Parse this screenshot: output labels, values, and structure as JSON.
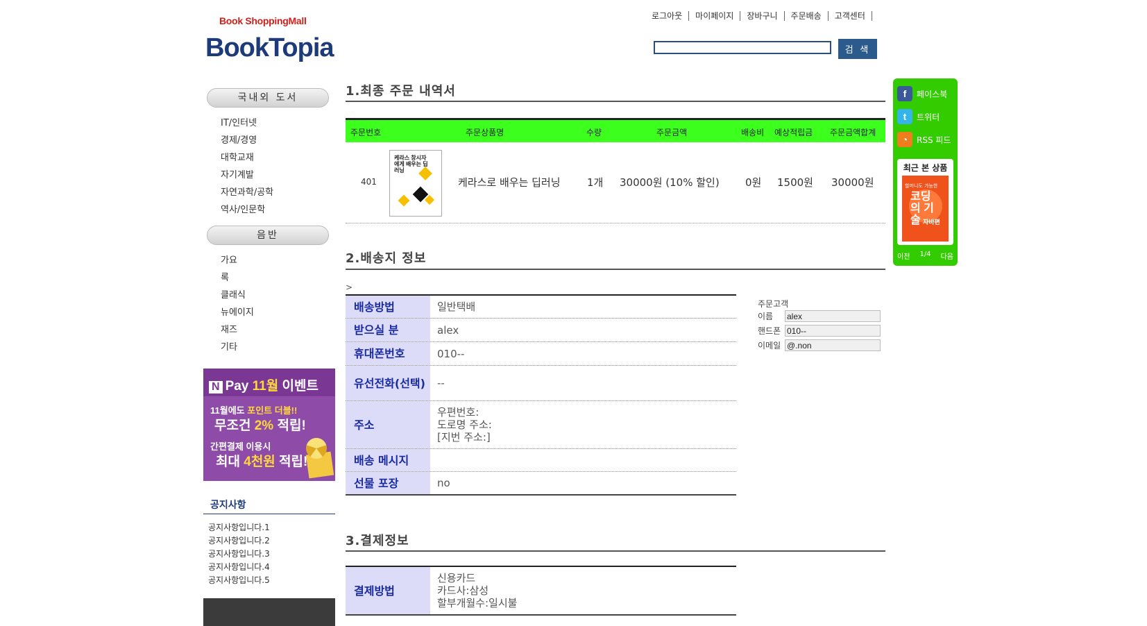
{
  "header": {
    "logo_sub": "Book ShoppingMall",
    "logo_main": "BookTopia",
    "nav": [
      "로그아웃",
      "마이페이지",
      "장바구니",
      "주문배송",
      "고객센터"
    ],
    "search_value": "",
    "search_button": "검 색"
  },
  "sidebar": {
    "category1": {
      "title": "국내외 도서",
      "items": [
        "IT/인터넷",
        "경제/경영",
        "대학교재",
        "자기계발",
        "자연과학/공학",
        "역사/인문학"
      ]
    },
    "category2": {
      "title": "음반",
      "items": [
        "가요",
        "록",
        "클래식",
        "뉴에이지",
        "재즈",
        "기타"
      ]
    },
    "banner": {
      "logo_letter": "N",
      "line0_a": "Pay",
      "line0_b": "11월",
      "line0_c": "이벤트",
      "line1_a": "11월에도",
      "line1_b": "포인트 더블!!",
      "line2_a": "무조건",
      "line2_b": "2%",
      "line2_c": "적립!",
      "line3_a": "간편결제",
      "line3_b": "이용시",
      "line4_a": "최대",
      "line4_b": "4천원",
      "line4_c": "적립!"
    },
    "notice": {
      "title": "공지사항",
      "items": [
        "공지사항입니다.1",
        "공지사항입니다.2",
        "공지사항입니다.3",
        "공지사항입니다.4",
        "공지사항입니다.5"
      ]
    }
  },
  "section1": {
    "title": "1.최종 주문 내역서",
    "columns": [
      "주문번호",
      "주문상품명",
      "수량",
      "주문금액",
      "배송비",
      "예상적립금",
      "주문금액합계"
    ],
    "row": {
      "order_no": "401",
      "thumb_text": "케라스 창시자에게 배우는 딥러닝",
      "product": "케라스로 배우는 딥러닝",
      "qty": "1개",
      "price": "30000원 (10% 할인)",
      "shipping": "0원",
      "points": "1500원",
      "total": "30000원"
    }
  },
  "section2": {
    "title": "2.배송지 정보",
    "marker": ">",
    "rows": [
      {
        "label": "배송방법",
        "value": "일반택배"
      },
      {
        "label": "받으실 분",
        "value": "alex"
      },
      {
        "label": "휴대폰번호",
        "value": "010--"
      },
      {
        "label": "유선전화(선택)",
        "value": "--"
      },
      {
        "label": "주소",
        "lines": [
          "우편번호:",
          "도로명 주소:",
          "[지번 주소:]"
        ]
      },
      {
        "label": "배송 메시지",
        "value": ""
      },
      {
        "label": "선물 포장",
        "value": "no"
      }
    ],
    "customer": {
      "title": "주문고객",
      "name_label": "이름",
      "name": "alex",
      "phone_label": "핸드폰",
      "phone": "010--",
      "email_label": "이메일",
      "email": "@.non"
    }
  },
  "section3": {
    "title": "3.결제정보",
    "rows": [
      {
        "label": "결제방법",
        "lines": [
          "신용카드",
          "카드사:삼성",
          "할부개월수:일시불"
        ]
      }
    ]
  },
  "right_panel": {
    "links": [
      {
        "label": "페이스북",
        "icon": "facebook-icon",
        "color": "#3b5998"
      },
      {
        "label": "트위터",
        "icon": "twitter-icon",
        "color": "#34b4e8"
      },
      {
        "label": "RSS 피드",
        "icon": "rss-icon",
        "color": "#f07d1d"
      }
    ],
    "recent_title": "최근 본 상품",
    "recent_book_t1": "할머니도 가능한",
    "recent_book_t2": "코딩의 기술",
    "recent_book_t3": "자바편",
    "prev": "이전",
    "page": "1/4",
    "next": "다음"
  }
}
